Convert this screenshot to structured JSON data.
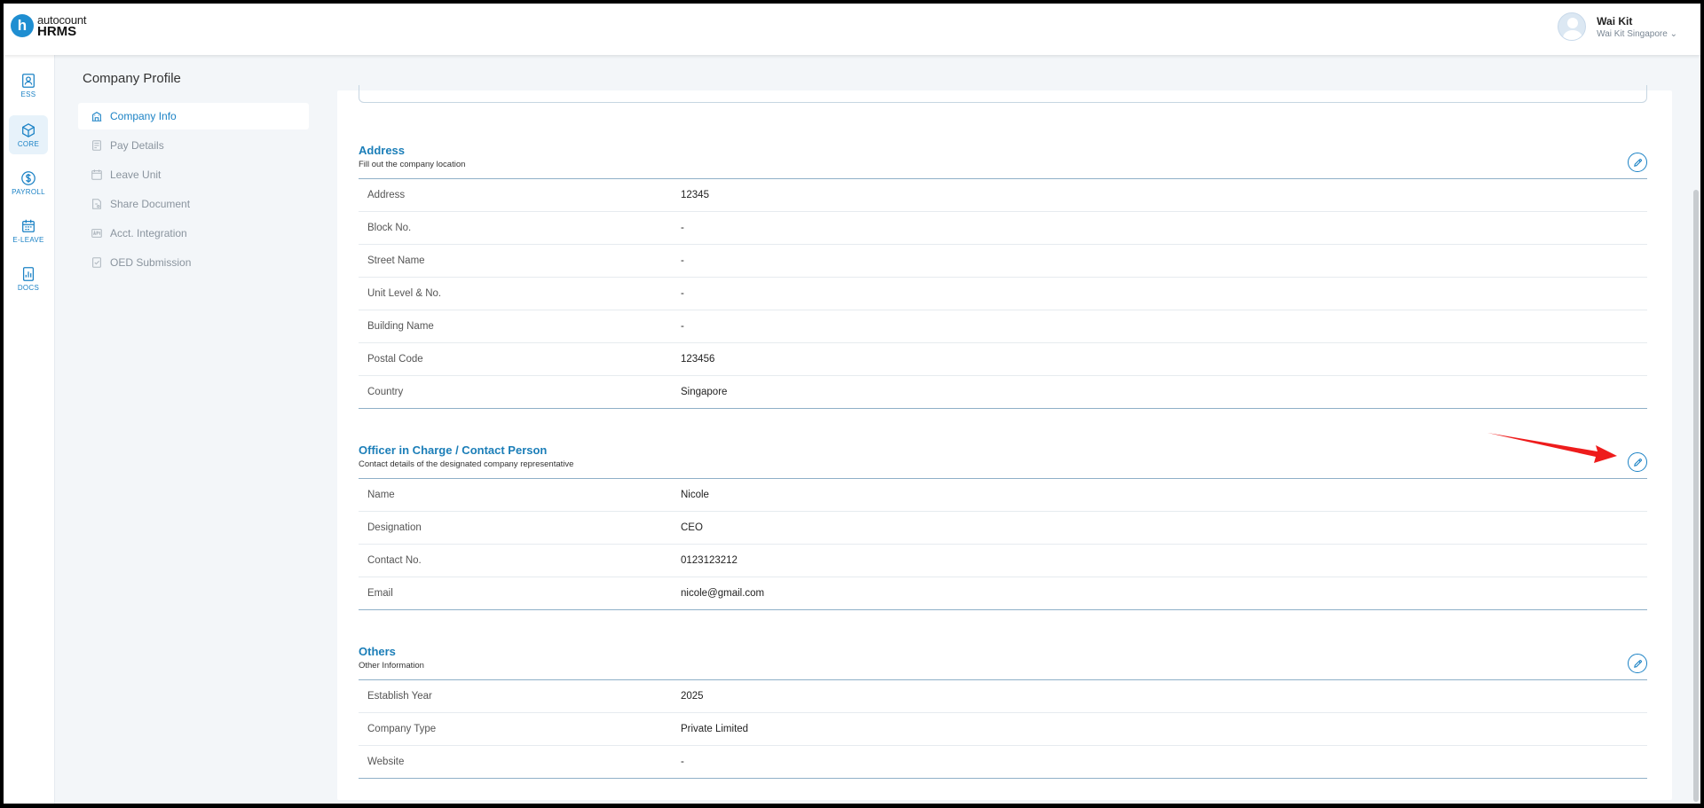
{
  "app": {
    "brand": "autocount",
    "product": "HRMS",
    "logo_letter": "h",
    "accent_color": "#1b82c5"
  },
  "user": {
    "name": "Wai Kit",
    "org": "Wai Kit Singapore"
  },
  "rail": [
    {
      "label": "ESS",
      "icon": "ess-icon"
    },
    {
      "label": "CORE",
      "icon": "core-icon",
      "active": true
    },
    {
      "label": "PAYROLL",
      "icon": "payroll-icon"
    },
    {
      "label": "E-LEAVE",
      "icon": "calendar-icon"
    },
    {
      "label": "DOCS",
      "icon": "docs-icon"
    }
  ],
  "page": {
    "title": "Company Profile"
  },
  "submenu": [
    {
      "label": "Company Info",
      "icon": "building-icon",
      "active": true
    },
    {
      "label": "Pay Details",
      "icon": "pay-icon"
    },
    {
      "label": "Leave Unit",
      "icon": "leave-icon"
    },
    {
      "label": "Share Document",
      "icon": "share-doc-icon"
    },
    {
      "label": "Acct. Integration",
      "icon": "api-icon"
    },
    {
      "label": "OED Submission",
      "icon": "submission-icon"
    }
  ],
  "address": {
    "title": "Address",
    "subtitle": "Fill out the company location",
    "rows": [
      {
        "label": "Address",
        "value": "12345"
      },
      {
        "label": "Block No.",
        "value": "-"
      },
      {
        "label": "Street Name",
        "value": "-"
      },
      {
        "label": "Unit Level & No.",
        "value": "-"
      },
      {
        "label": "Building Name",
        "value": "-"
      },
      {
        "label": "Postal Code",
        "value": "123456"
      },
      {
        "label": "Country",
        "value": "Singapore"
      }
    ]
  },
  "officer": {
    "title": "Officer in Charge / Contact Person",
    "subtitle": "Contact details of the designated company representative",
    "rows": [
      {
        "label": "Name",
        "value": "Nicole"
      },
      {
        "label": "Designation",
        "value": "CEO"
      },
      {
        "label": "Contact No.",
        "value": "0123123212"
      },
      {
        "label": "Email",
        "value": "nicole@gmail.com"
      }
    ]
  },
  "others": {
    "title": "Others",
    "subtitle": "Other Information",
    "rows": [
      {
        "label": "Establish Year",
        "value": "2025"
      },
      {
        "label": "Company Type",
        "value": "Private Limited"
      },
      {
        "label": "Website",
        "value": "-"
      }
    ]
  }
}
